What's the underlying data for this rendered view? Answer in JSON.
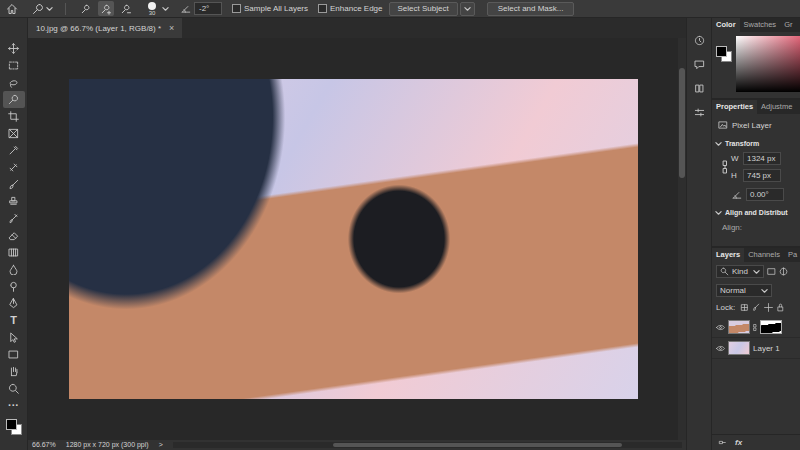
{
  "options_bar": {
    "modes": [
      {
        "kind": "new",
        "selected": false
      },
      {
        "kind": "add",
        "selected": true
      },
      {
        "kind": "subtract",
        "selected": false
      }
    ],
    "brush_size": "30",
    "angle": "-2°",
    "checkboxes": [
      {
        "label": "Sample All Layers",
        "checked": false
      },
      {
        "label": "Enhance Edge",
        "checked": false
      }
    ],
    "buttons": [
      "Select Subject",
      "Select and Mask..."
    ]
  },
  "document": {
    "title": "10.jpg @ 66.7% (Layer 1, RGB/8) *",
    "close": "×"
  },
  "tools": [
    {
      "kind": "move",
      "selected": false
    },
    {
      "kind": "marquee",
      "selected": false
    },
    {
      "kind": "lasso",
      "selected": false
    },
    {
      "kind": "quick-select",
      "selected": true
    },
    {
      "kind": "crop",
      "selected": false
    },
    {
      "kind": "frame",
      "selected": false
    },
    {
      "kind": "eyedropper",
      "selected": false
    },
    {
      "kind": "heal",
      "selected": false
    },
    {
      "kind": "brush",
      "selected": false
    },
    {
      "kind": "stamp",
      "selected": false
    },
    {
      "kind": "history",
      "selected": false
    },
    {
      "kind": "eraser",
      "selected": false
    },
    {
      "kind": "gradient",
      "selected": false
    },
    {
      "kind": "blur",
      "selected": false
    },
    {
      "kind": "dodge",
      "selected": false
    },
    {
      "kind": "pen",
      "selected": false
    },
    {
      "kind": "type",
      "glyph": "T",
      "selected": false
    },
    {
      "kind": "path-select",
      "selected": false
    },
    {
      "kind": "shape",
      "selected": false
    },
    {
      "kind": "hand",
      "selected": false
    },
    {
      "kind": "zoom",
      "selected": false
    },
    {
      "kind": "more",
      "glyph": "···",
      "selected": false
    }
  ],
  "colors": {
    "foreground": "#000000",
    "background": "#ffffff"
  },
  "status_bar": {
    "zoom": "66.67%",
    "size": "1280 px x 720 px (300 ppi)",
    "arrow": ">"
  },
  "color_panel": {
    "tabs": [
      {
        "label": "Color",
        "selected": true
      },
      {
        "label": "Swatches",
        "selected": false
      },
      {
        "label": "Gr",
        "selected": false
      }
    ]
  },
  "properties": {
    "tabs": [
      {
        "label": "Properties",
        "selected": true
      },
      {
        "label": "Adjustme",
        "selected": false
      }
    ],
    "layer_kind": "Pixel Layer",
    "transform": {
      "title": "Transform",
      "expanded": true,
      "w_label": "W",
      "w": "1324 px",
      "h_label": "H",
      "h": "745 px",
      "angle": "0.00°"
    },
    "align": {
      "title": "Align and Distribut",
      "expanded": true,
      "label": "Align:"
    }
  },
  "layers": {
    "tabs": [
      {
        "label": "Layers",
        "selected": true
      },
      {
        "label": "Channels",
        "selected": false
      },
      {
        "label": "Pa",
        "selected": false
      }
    ],
    "filter": "Kind",
    "blend": "Normal",
    "lock_label": "Lock:",
    "items": [
      {
        "visible": true,
        "masked": true,
        "selected": false
      },
      {
        "name": "Layer 1",
        "visible": true,
        "masked": false,
        "selected": false
      }
    ],
    "footer": "fx"
  }
}
